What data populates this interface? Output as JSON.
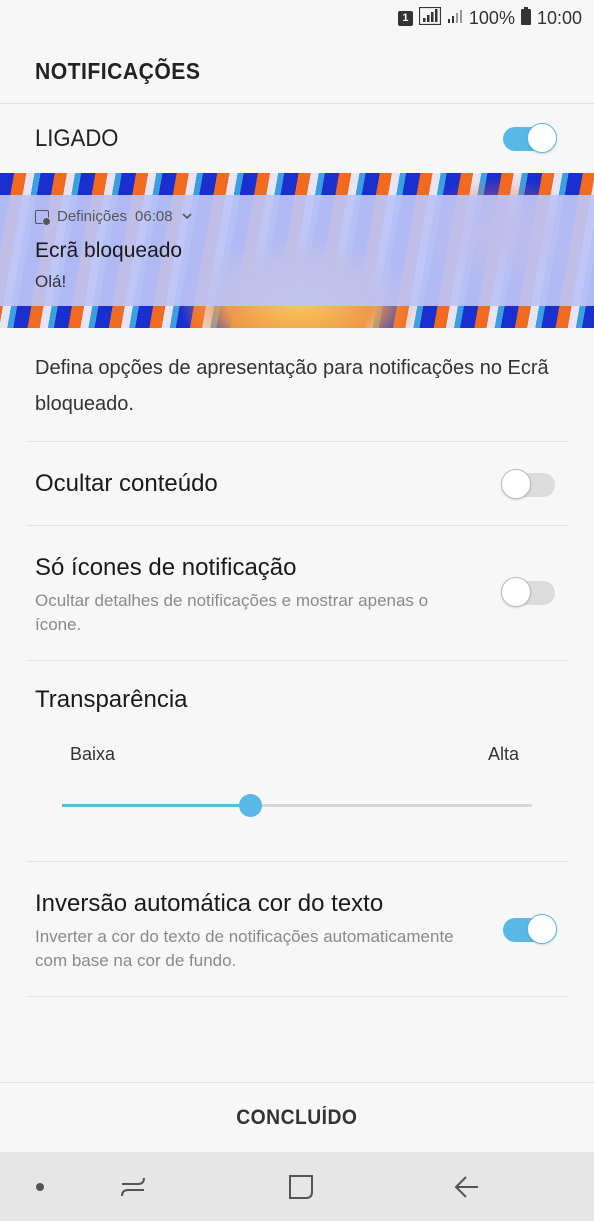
{
  "status_bar": {
    "sim_badge": "1",
    "battery_percent": "100%",
    "time": "10:00"
  },
  "header": {
    "title": "NOTIFICAÇÕES"
  },
  "master_toggle": {
    "label": "LIGADO",
    "on": true
  },
  "preview": {
    "app_name": "Definições",
    "time": "06:08",
    "title": "Ecrã bloqueado",
    "body": "Olá!"
  },
  "description": "Defina opções de apresentação para notificações no Ecrã bloqueado.",
  "settings": {
    "hide_content": {
      "title": "Ocultar conteúdo",
      "on": false
    },
    "icons_only": {
      "title": "Só ícones de notificação",
      "subtitle": "Ocultar detalhes de notificações e mostrar apenas o ícone.",
      "on": false
    },
    "transparency": {
      "title": "Transparência",
      "min_label": "Baixa",
      "max_label": "Alta",
      "level": 0.4
    },
    "auto_invert": {
      "title": "Inversão automática cor do texto",
      "subtitle": "Inverter a cor do texto de notificações automaticamente com base na cor de fundo.",
      "on": true
    }
  },
  "done_button": "CONCLUÍDO",
  "colors": {
    "accent": "#5ab8e6",
    "background": "#f7f7f7",
    "nav_bar": "#e6e6e6"
  },
  "icons": {
    "nav": [
      "recent-apps-icon",
      "home-icon",
      "back-icon"
    ]
  }
}
